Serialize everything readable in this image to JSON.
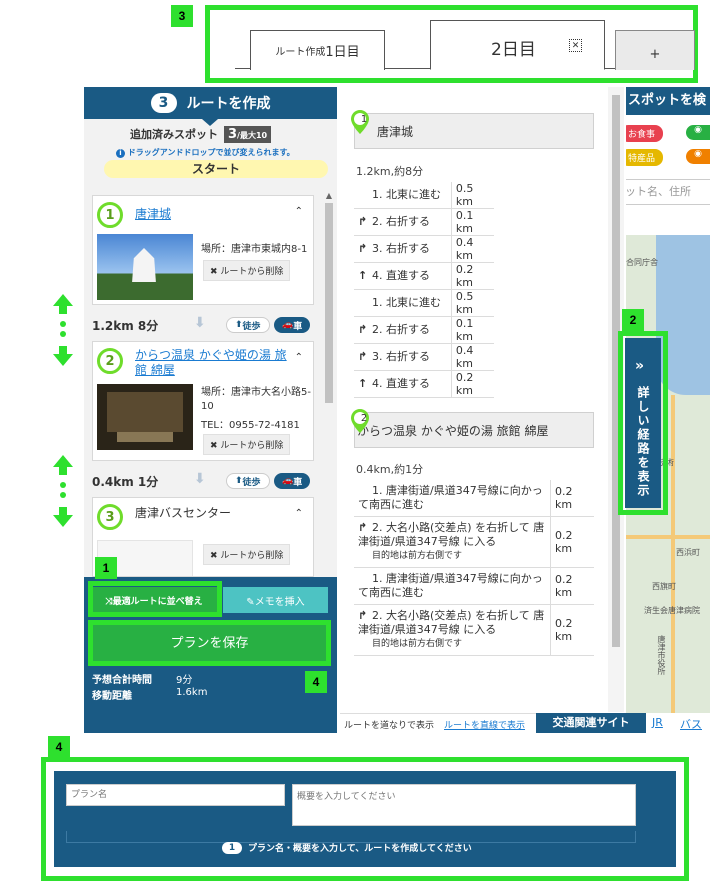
{
  "callouts": {
    "c1": "1",
    "c2": "2",
    "c3": "3",
    "c4a": "4",
    "c4b": "4"
  },
  "tabs": {
    "day1_prefix": "ルート作成",
    "day1_suffix": "1日目",
    "day2": "2日目",
    "add": "+",
    "close_glyph": "✕"
  },
  "left_panel": {
    "step_number": "3",
    "header": "ルートを作成",
    "added_label": "追加済みスポット",
    "added_count": "3",
    "added_max": "/最大10",
    "drag_hint": "ドラッグアンドドロップで並び変えられます。",
    "start": "スタート",
    "spots": [
      {
        "num": "1",
        "name": "唐津城",
        "addr": "場所：唐津市東城内8-1",
        "remove": "ルートから削除"
      },
      {
        "num": "2",
        "name": "からつ温泉 かぐや姫の湯 旅館 綿屋",
        "addr": "場所：唐津市大名小路5-10",
        "tel": "TEL：0955-72-4181",
        "remove": "ルートから削除"
      },
      {
        "num": "3",
        "name": "唐津バスセンター",
        "remove": "ルートから削除"
      }
    ],
    "legs": [
      {
        "distance": "1.2km 8分",
        "walk": "徒歩",
        "car": "車"
      },
      {
        "distance": "0.4km 1分",
        "walk": "徒歩",
        "car": "車"
      }
    ],
    "optimize_btn": "最適ルートに並べ替え",
    "memo_btn": "メモを挿入",
    "save_btn": "プランを保存",
    "total_time_label": "予想合計時間",
    "total_time": "9分",
    "distance_label": "移動距離",
    "distance": "1.6km"
  },
  "mid_panel": {
    "dest1": {
      "num": "1",
      "name": "唐津城",
      "summary": "1.2km,約8分",
      "steps": [
        {
          "icon": "",
          "text": "1. 北東に進む",
          "dist": "0.5 km"
        },
        {
          "icon": "↱",
          "text": "2. 右折する",
          "dist": "0.1 km"
        },
        {
          "icon": "↱",
          "text": "3. 右折する",
          "dist": "0.4 km"
        },
        {
          "icon": "↑",
          "text": "4. 直進する",
          "dist": "0.2 km"
        },
        {
          "icon": "",
          "text": "1. 北東に進む",
          "dist": "0.5 km"
        },
        {
          "icon": "↱",
          "text": "2. 右折する",
          "dist": "0.1 km"
        },
        {
          "icon": "↱",
          "text": "3. 右折する",
          "dist": "0.4 km"
        },
        {
          "icon": "↑",
          "text": "4. 直進する",
          "dist": "0.2 km"
        }
      ]
    },
    "dest2": {
      "num": "2",
      "name": "からつ温泉 かぐや姫の湯 旅館 綿屋",
      "summary": "0.4km,約1分",
      "steps": [
        {
          "icon": "",
          "text": "1. 唐津街道/県道347号線に向かって南西に進む",
          "dist": "0.2 km"
        },
        {
          "icon": "↱",
          "text": "2. 大名小路(交差点) を右折して 唐津街道/県道347号線 に入る",
          "note": "目的地は前方右側です",
          "dist": "0.2 km"
        },
        {
          "icon": "",
          "text": "1. 唐津街道/県道347号線に向かって南西に進む",
          "dist": "0.2 km"
        },
        {
          "icon": "↱",
          "text": "2. 大名小路(交差点) を右折して 唐津街道/県道347号線 に入る",
          "note": "目的地は前方右側です",
          "dist": "0.2 km"
        }
      ]
    },
    "footer_text": "ルートを道なりで表示",
    "footer_link": "ルートを直線で表示",
    "traffic_btn": "交通関連サイト",
    "jr": "JR",
    "bus": "バス"
  },
  "map_panel": {
    "search_title": "スポットを検",
    "tag1": "お食事",
    "tag2": "特産品",
    "search_placeholder": "ット名、住所",
    "route_btn": "詳しい経路を表示",
    "labels": [
      "合同庁舎",
      "科学技術",
      "西浜町",
      "西旗町",
      "済生会唐津病院",
      "唐津市役所"
    ]
  },
  "plan_form": {
    "name_placeholder": "プラン名",
    "summary_placeholder": "概要を入力してください",
    "hint_num": "1",
    "hint": "プラン名・概要を入力して、ルートを作成してください"
  }
}
